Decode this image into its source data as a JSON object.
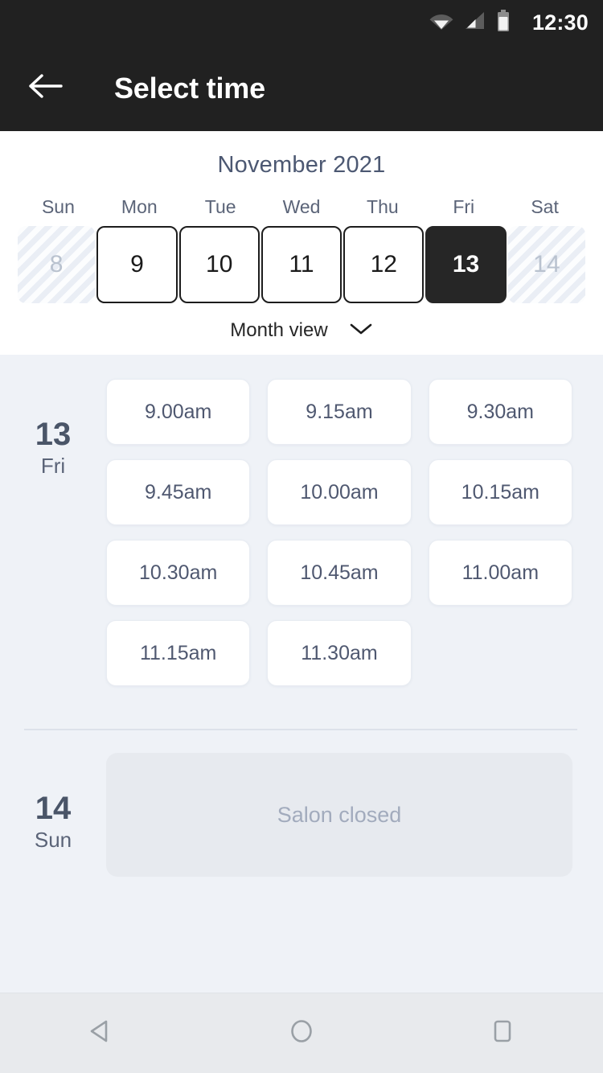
{
  "status_bar": {
    "time": "12:30",
    "icons": [
      "wifi-icon",
      "cellular-signal-icon",
      "battery-icon"
    ]
  },
  "app_bar": {
    "back_icon": "arrow-left-icon",
    "title": "Select time"
  },
  "calendar": {
    "month_title": "November 2021",
    "weekdays": [
      "Sun",
      "Mon",
      "Tue",
      "Wed",
      "Thu",
      "Fri",
      "Sat"
    ],
    "days": [
      {
        "num": "8",
        "state": "disabled"
      },
      {
        "num": "9",
        "state": "available"
      },
      {
        "num": "10",
        "state": "available"
      },
      {
        "num": "11",
        "state": "available"
      },
      {
        "num": "12",
        "state": "available"
      },
      {
        "num": "13",
        "state": "selected"
      },
      {
        "num": "14",
        "state": "disabled"
      }
    ],
    "month_view_label": "Month view",
    "month_view_icon": "chevron-down-icon"
  },
  "schedule": {
    "groups": [
      {
        "day_number": "13",
        "day_of_week": "Fri",
        "slots": [
          "9.00am",
          "9.15am",
          "9.30am",
          "9.45am",
          "10.00am",
          "10.15am",
          "10.30am",
          "10.45am",
          "11.00am",
          "11.15am",
          "11.30am"
        ]
      }
    ],
    "closed_group": {
      "day_number": "14",
      "day_of_week": "Sun",
      "message": "Salon closed"
    }
  },
  "nav_bar": {
    "back_icon": "triangle-back-icon",
    "home_icon": "circle-home-icon",
    "recents_icon": "square-recents-icon"
  },
  "colors": {
    "app_bar_bg": "#212121",
    "selected_day_bg": "#262626",
    "page_bg": "#eff2f7",
    "slot_card_bg": "#ffffff",
    "closed_box_bg": "#e7eaef",
    "title_text": "#4c5872",
    "nav_bar_bg": "#e8eaed"
  }
}
